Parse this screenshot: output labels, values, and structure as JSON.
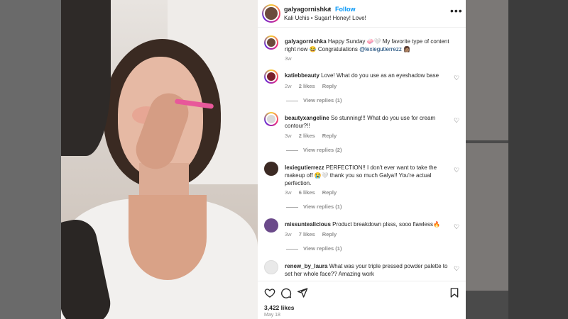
{
  "post": {
    "username": "galyagornishka",
    "separator": "•",
    "follow_label": "Follow",
    "audio": "Kali Uchis • Sugar! Honey! Love!",
    "caption_user": "galyagornishka",
    "caption_text_1": "Happy Sunday 🧼🤍 My favorite type of content right now 😂 Congratulations ",
    "caption_mention": "@lexiegutierrezz",
    "caption_emoji_end": " 👩🏽",
    "caption_time": "3w",
    "likes": "3,422 likes",
    "date": "May 18"
  },
  "comments": [
    {
      "user": "katiebbeauty",
      "text": "Love! What do you use as an eyeshadow base",
      "time": "2w",
      "likes": "2 likes",
      "reply_label": "Reply",
      "view_replies": "View replies (1)",
      "avatar_color": "#7a1f2b"
    },
    {
      "user": "beautyxangeline",
      "text": "So stunning!!! What do you use for cream contour?!!",
      "time": "3w",
      "likes": "2 likes",
      "reply_label": "Reply",
      "view_replies": "View replies (2)",
      "avatar_color": "#d9d9d9"
    },
    {
      "user": "lexiegutierrezz",
      "text": "PERFECTION!! I don't ever want to take the makeup off 😭🤍 thank you so much Galya!! You're actual perfection.",
      "time": "3w",
      "likes": "6 likes",
      "reply_label": "Reply",
      "view_replies": "View replies (1)",
      "avatar_color": "#3c2a24"
    },
    {
      "user": "missuntealicious",
      "text": "Product breakdown plsss, sooo flawless🔥",
      "time": "3w",
      "likes": "7 likes",
      "reply_label": "Reply",
      "view_replies": "View replies (1)",
      "avatar_color": "#6b4a8a"
    },
    {
      "user": "renew_by_laura",
      "text": "What was your triple pressed powder palette to set her whole face?? Amazing work",
      "avatar_color": "#e9e9e9"
    }
  ],
  "icons": {
    "more": "more-options-icon",
    "heart": "heart-icon",
    "like": "like-icon",
    "comment": "comment-icon",
    "share": "share-icon",
    "save": "bookmark-icon"
  },
  "colors": {
    "link": "#0095f6",
    "mention": "#00376b",
    "muted": "#8e8e8e",
    "text": "#262626"
  }
}
